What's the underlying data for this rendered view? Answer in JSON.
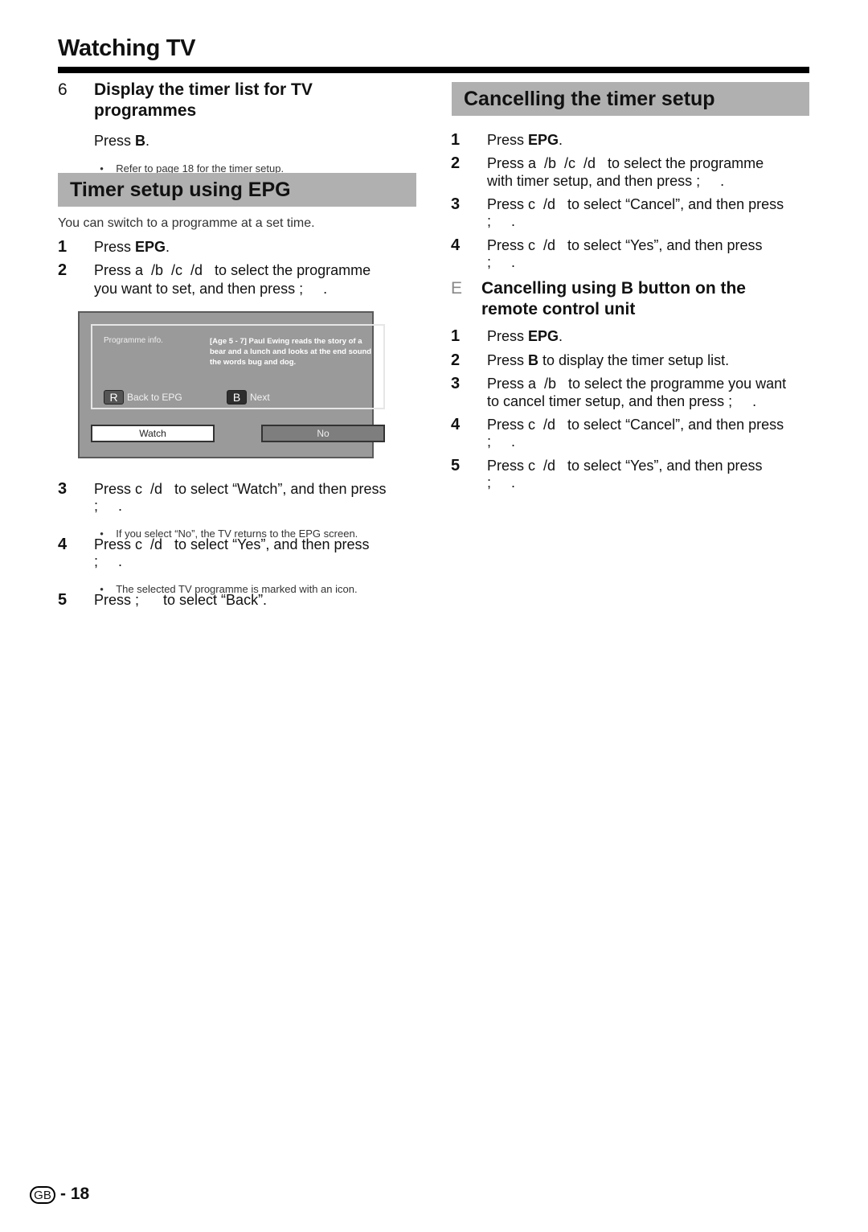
{
  "header": {
    "title": "Watching TV"
  },
  "left": {
    "display_timer": {
      "number": "6",
      "title_line1": "Display the timer list for TV",
      "title_line2": "programmes",
      "press_prefix": "Press ",
      "press_key": "B",
      "press_suffix": ".",
      "note": "Refer to page 18 for the timer setup."
    },
    "timer_setup": {
      "heading": "Timer setup using EPG",
      "intro": "You can switch to a programme at a set time.",
      "steps": [
        {
          "n": "1",
          "prefix": "Press ",
          "key": "EPG",
          "suffix": "."
        },
        {
          "n": "2",
          "line1": "Press a  /b  /c  /d   to select the programme",
          "line2": "you want to set, and then press ;     ."
        },
        {
          "n": "3",
          "line1": "Press c  /d   to select “Watch”, and then press",
          "line2": ";     .",
          "note": "If you select “No”, the TV returns to the EPG screen."
        },
        {
          "n": "4",
          "line1": "Press c  /d   to select “Yes”, and then press",
          "line2": ";     .",
          "note": "The selected TV programme is marked with an icon."
        },
        {
          "n": "5",
          "line1": "Press ;      to select “Back”."
        }
      ]
    },
    "tv_screen": {
      "info_label": "Programme info.",
      "info_desc": "[Age 5 - 7] Paul Ewing reads the story of a bear and a lunch and looks at the end sound the words bug and dog.",
      "back_key": "R",
      "back_label": "Back to EPG",
      "next_key": "B",
      "next_label": "Next",
      "watch_label": "Watch",
      "no_label": "No"
    }
  },
  "right": {
    "cancel": {
      "heading": "Cancelling the timer setup",
      "steps": [
        {
          "n": "1",
          "prefix": "Press ",
          "key": "EPG",
          "suffix": "."
        },
        {
          "n": "2",
          "line1": "Press a  /b  /c  /d   to select the programme",
          "line2": "with timer setup, and then press ;     ."
        },
        {
          "n": "3",
          "line1": "Press c  /d   to select “Cancel”, and then press",
          "line2": ";     ."
        },
        {
          "n": "4",
          "line1": "Press c  /d   to select “Yes”, and then press",
          "line2": ";     ."
        }
      ]
    },
    "cancel_b": {
      "marker": "E",
      "title_line1": "Cancelling using B button on the",
      "title_line2": "remote control unit",
      "steps": [
        {
          "n": "1",
          "prefix": "Press ",
          "key": "EPG",
          "suffix": "."
        },
        {
          "n": "2",
          "prefix": "Press ",
          "key": "B",
          "suffix": " to display the timer setup list."
        },
        {
          "n": "3",
          "line1": "Press a  /b   to select the programme you want",
          "line2": "to cancel timer setup, and then press ;     ."
        },
        {
          "n": "4",
          "line1": "Press c  /d   to select “Cancel”, and then press",
          "line2": ";     ."
        },
        {
          "n": "5",
          "line1": "Press c  /d   to select “Yes”, and then press",
          "line2": ";     ."
        }
      ]
    }
  },
  "footer": {
    "region_badge": "GB",
    "page_number": "- 18"
  }
}
